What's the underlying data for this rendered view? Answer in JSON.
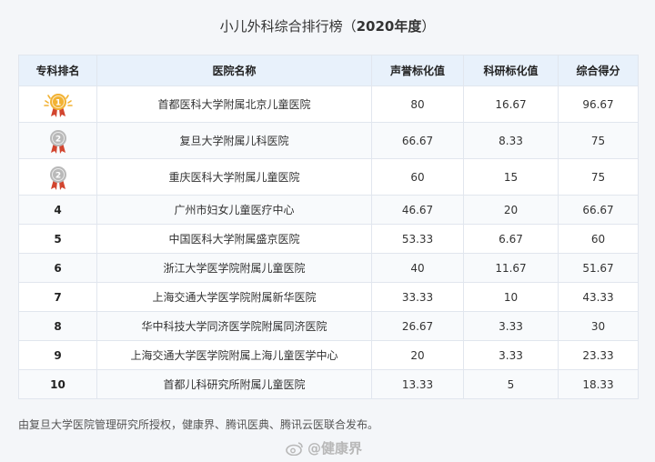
{
  "title": {
    "main": "小儿外科综合排行榜（",
    "year": "2020年度",
    "close": "）"
  },
  "table": {
    "headers": [
      "专科排名",
      "医院名称",
      "声誉标化值",
      "科研标化值",
      "综合得分"
    ],
    "rows": [
      {
        "rank": "1",
        "medal": "gold",
        "hospital": "首都医科大学附属北京儿童医院",
        "reputation": "80",
        "research": "16.67",
        "score": "96.67"
      },
      {
        "rank": "2",
        "medal": "silver",
        "hospital": "复旦大学附属儿科医院",
        "reputation": "66.67",
        "research": "8.33",
        "score": "75"
      },
      {
        "rank": "2",
        "medal": "silver",
        "hospital": "重庆医科大学附属儿童医院",
        "reputation": "60",
        "research": "15",
        "score": "75"
      },
      {
        "rank": "4",
        "hospital": "广州市妇女儿童医疗中心",
        "reputation": "46.67",
        "research": "20",
        "score": "66.67"
      },
      {
        "rank": "5",
        "hospital": "中国医科大学附属盛京医院",
        "reputation": "53.33",
        "research": "6.67",
        "score": "60"
      },
      {
        "rank": "6",
        "hospital": "浙江大学医学院附属儿童医院",
        "reputation": "40",
        "research": "11.67",
        "score": "51.67"
      },
      {
        "rank": "7",
        "hospital": "上海交通大学医学院附属新华医院",
        "reputation": "33.33",
        "research": "10",
        "score": "43.33"
      },
      {
        "rank": "8",
        "hospital": "华中科技大学同济医学院附属同济医院",
        "reputation": "26.67",
        "research": "3.33",
        "score": "30"
      },
      {
        "rank": "9",
        "hospital": "上海交通大学医学院附属上海儿童医学中心",
        "reputation": "20",
        "research": "3.33",
        "score": "23.33"
      },
      {
        "rank": "10",
        "hospital": "首都儿科研究所附属儿童医院",
        "reputation": "13.33",
        "research": "5",
        "score": "18.33"
      }
    ]
  },
  "note": "由复旦大学医院管理研究所授权，健康界、腾讯医典、腾讯云医联合发布。",
  "watermark": "@健康界",
  "colors": {
    "header_bg": "#e8f1fb",
    "gold": "#f2b233",
    "silver": "#b9b9b9",
    "ribbon": "#d2452f"
  }
}
